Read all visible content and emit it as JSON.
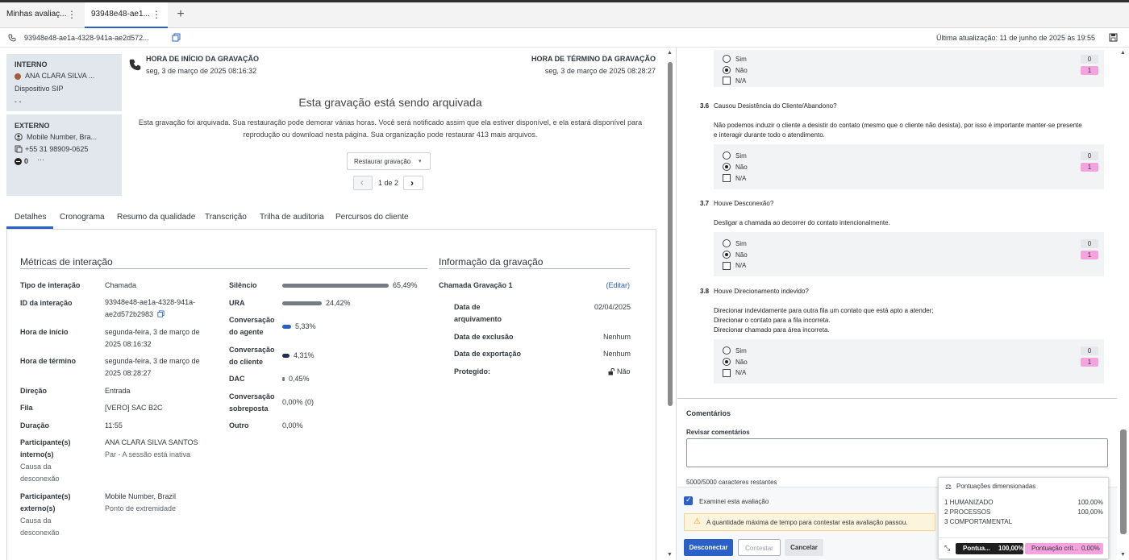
{
  "tabs": [
    {
      "label": "Minhas avaliaç..."
    },
    {
      "label": "93948e48-ae1..."
    }
  ],
  "subbar": {
    "interaction_id": "93948e48-ae1a-4328-941a-ae2d572...",
    "last_update": "Última atualização: 11 de junho de 2025 às 19:55"
  },
  "internal": {
    "title": "INTERNO",
    "agent": "ANA CLARA SILVA ...",
    "device": "Dispositivo SIP",
    "extra": "- -"
  },
  "external": {
    "title": "EXTERNO",
    "name": "Mobile Number, Bra...",
    "phone": "+55 31 98909-0625",
    "count": "0",
    "more": "···"
  },
  "recording": {
    "start_label": "HORA DE INÍCIO DA GRAVAÇÃO",
    "start_value": "seg, 3 de março de 2025 08:16:32",
    "end_label": "HORA DE TÉRMINO DA GRAVAÇÃO",
    "end_value": "seg, 3 de março de 2025 08:28:27",
    "archive_title": "Esta gravação está sendo arquivada",
    "archive_line1": "Esta gravação foi arquivada. Sua restauração pode demorar várias horas. Você será notificado assim que ela estiver disponível, e ela estará disponível para",
    "archive_line2": "reprodução ou download nesta página. Sua organização pode restaurar 413 mais arquivos.",
    "restore_button": "Restaurar gravação",
    "pager": "1 de 2"
  },
  "nav_tabs": [
    "Detalhes",
    "Cronograma",
    "Resumo da qualidade",
    "Transcrição",
    "Trilha de auditoria",
    "Percursos do cliente"
  ],
  "metrics": {
    "title": "Métricas de interação",
    "type_label": "Tipo de interação",
    "type_value": "Chamada",
    "id_label": "ID da interação",
    "id_value1": "93948e48-ae1a-4328-941a-",
    "id_value2": "ae2d572b2983",
    "start_label": "Hora de início",
    "start_value1": "segunda-feira, 3 de março de",
    "start_value2": "2025 08:16:32",
    "end_label": "Hora de término",
    "end_value1": "segunda-feira, 3 de março de",
    "end_value2": "2025 08:28:27",
    "direction_label": "Direção",
    "direction_value": "Entrada",
    "queue_label": "Fila",
    "queue_value": "[VERO] SAC B2C",
    "duration_label": "Duração",
    "duration_value": "11:55",
    "internal_label1": "Participante(s)",
    "internal_label2": "interno(s)",
    "internal_value": "ANA CLARA SILVA SANTOS",
    "internal_status": "Par - A sessão está inativa",
    "cause_label1": "Causa da",
    "cause_label2": "desconexão",
    "external_label1": "Participante(s)",
    "external_label2": "externo(s)",
    "external_value": "Mobile Number, Brazil",
    "external_status": "Ponto de extremidade",
    "cause2_label1": "Causa da",
    "cause2_label2": "desconexão"
  },
  "bars": [
    {
      "label1": "Silêncio",
      "label2": "",
      "value": "65,49%",
      "fraction": 0.6549,
      "color": "#767c84"
    },
    {
      "label1": "URA",
      "label2": "",
      "value": "24,42%",
      "fraction": 0.2442,
      "color": "#767c84"
    },
    {
      "label1": "Conversação",
      "label2": "do agente",
      "value": "5,33%",
      "fraction": 0.0533,
      "color": "#2a60c8"
    },
    {
      "label1": "Conversação",
      "label2": "do cliente",
      "value": "4,31%",
      "fraction": 0.0431,
      "color": "#1f2f52"
    },
    {
      "label1": "DAC",
      "label2": "",
      "value": "0,45%",
      "fraction": 0.0045,
      "color": "#767c84"
    }
  ],
  "overlap": {
    "label1": "Conversação",
    "label2": "sobreposta",
    "value": "0,00% (0)"
  },
  "other": {
    "label": "Outro",
    "value": "0,00%"
  },
  "recinfo": {
    "title": "Informação da gravação",
    "name": "Chamada Gravação 1",
    "edit": "(Editar)",
    "archive_label1": "Data de",
    "archive_label2": "arquivamento",
    "archive_value": "02/04/2025",
    "delete_label": "Data de exclusão",
    "delete_value": "Nenhum",
    "export_label": "Data de exportação",
    "export_value": "Nenhum",
    "protected_label": "Protegido:",
    "protected_value": "Não"
  },
  "evaluation": {
    "options": [
      "Sim",
      "Não",
      "N/A"
    ],
    "score_yes": "0",
    "score_no": "1",
    "q36_num": "3.6",
    "q36_title": "Causou Desistência do Cliente/Abandono?",
    "q36_desc1": "Não podemos induzir o cliente a desistir do contato (mesmo que o cliente não desista), por isso é importante manter-se presente",
    "q36_desc2": "e interagir durante todo o atendimento.",
    "q37_num": "3.7",
    "q37_title": "Houve Desconexão?",
    "q37_desc1": "Desligar a chamada ao decorrer do contato intencionalmente.",
    "q38_num": "3.8",
    "q38_title": "Houve Direcionamento indevido?",
    "q38_desc1": "Direcionar indevidamente para outra fila um contato que está apto a atender;",
    "q38_desc2": "Direcionar o contato para a fila incorreta.",
    "q38_desc3": "Direcionar chamado para área incorreta."
  },
  "comments": {
    "title": "Comentários",
    "review_label": "Revisar comentários",
    "remaining": "5000/5000 caracteres restantes"
  },
  "footer": {
    "checkbox_label": "Examinei esta avaliação",
    "warning": "A quantidade máxima de tempo para contestar esta avaliação passou.",
    "disconnect": "Desconectar",
    "contest": "Contestar",
    "cancel": "Cancelar"
  },
  "dimension_scores": {
    "title": "Pontuações dimensionadas",
    "rows": [
      {
        "label": "1 HUMANIZADO",
        "value": "100,00%"
      },
      {
        "label": "2 PROCESSOS",
        "value": "100,00%"
      },
      {
        "label": "3 COMPORTAMENTAL",
        "value": ""
      }
    ],
    "score_label": "Pontua...",
    "score_value": "100,00%",
    "critical_label": "Pontuação crít...",
    "critical_value": "0,00%"
  }
}
